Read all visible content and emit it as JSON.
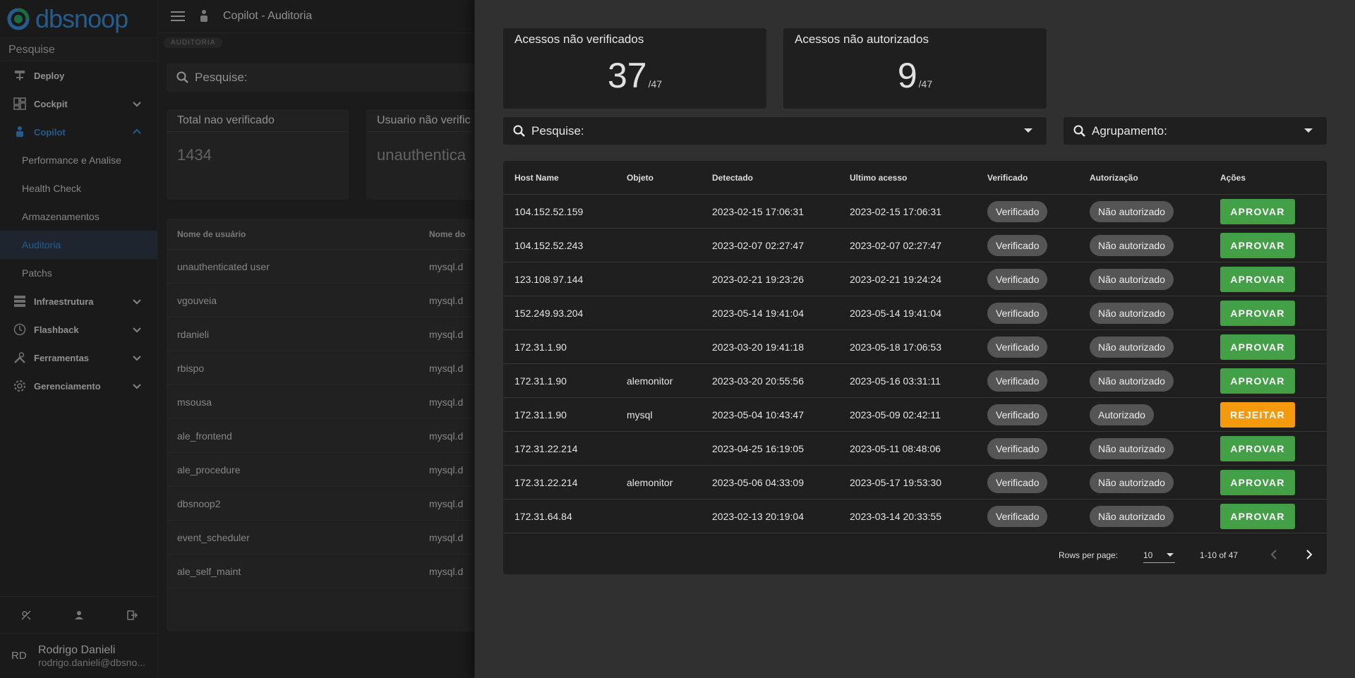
{
  "sidebar": {
    "logo_text": "dbsnoop",
    "search_placeholder": "Pesquise",
    "items": [
      {
        "label": "Deploy"
      },
      {
        "label": "Cockpit"
      },
      {
        "label": "Copilot"
      },
      {
        "label": "Infraestrutura"
      },
      {
        "label": "Flashback"
      },
      {
        "label": "Ferramentas"
      },
      {
        "label": "Gerenciamento"
      }
    ],
    "copilot_sub": [
      {
        "label": "Performance e Analise"
      },
      {
        "label": "Health Check"
      },
      {
        "label": "Armazenamentos"
      },
      {
        "label": "Auditoria"
      },
      {
        "label": "Patchs"
      }
    ],
    "user": {
      "initials": "RD",
      "name": "Rodrigo Danieli",
      "email": "rodrigo.danieli@dbsno..."
    }
  },
  "main": {
    "title": "Copilot - Auditoria",
    "breadcrumb": "AUDITORIA",
    "search_label": "Pesquise:",
    "cards": [
      {
        "label": "Total nao verificado",
        "value": "1434"
      },
      {
        "label": "Usuario não verific",
        "value": "unauthentica"
      }
    ],
    "table_headers": [
      "Nome de usuário",
      "Nome do"
    ],
    "rows": [
      {
        "user": "unauthenticated user",
        "name": "mysql.d"
      },
      {
        "user": "vgouveia",
        "name": "mysql.d"
      },
      {
        "user": "rdanieli",
        "name": "mysql.d"
      },
      {
        "user": "rbispo",
        "name": "mysql.d"
      },
      {
        "user": "msousa",
        "name": "mysql.d"
      },
      {
        "user": "ale_frontend",
        "name": "mysql.d"
      },
      {
        "user": "ale_procedure",
        "name": "mysql.d"
      },
      {
        "user": "dbsnoop2",
        "name": "mysql.d"
      },
      {
        "user": "event_scheduler",
        "name": "mysql.d"
      },
      {
        "user": "ale_self_maint",
        "name": "mysql.d"
      }
    ]
  },
  "drawer": {
    "stats": [
      {
        "label": "Acessos não verificados",
        "value": "37",
        "total": "/47"
      },
      {
        "label": "Acessos não autorizados",
        "value": "9",
        "total": "/47"
      }
    ],
    "search_label": "Pesquise:",
    "group_label": "Agrupamento:",
    "headers": [
      "Host Name",
      "Objeto",
      "Detectado",
      "Ultimo acesso",
      "Verificado",
      "Autorização",
      "Ações"
    ],
    "rows": [
      {
        "host": "104.152.52.159",
        "obj": "",
        "det": "2023-02-15 17:06:31",
        "last": "2023-02-15 17:06:31",
        "ver": "Verificado",
        "aut": "Não autorizado",
        "act": "APROVAR"
      },
      {
        "host": "104.152.52.243",
        "obj": "",
        "det": "2023-02-07 02:27:47",
        "last": "2023-02-07 02:27:47",
        "ver": "Verificado",
        "aut": "Não autorizado",
        "act": "APROVAR"
      },
      {
        "host": "123.108.97.144",
        "obj": "",
        "det": "2023-02-21 19:23:26",
        "last": "2023-02-21 19:24:24",
        "ver": "Verificado",
        "aut": "Não autorizado",
        "act": "APROVAR"
      },
      {
        "host": "152.249.93.204",
        "obj": "",
        "det": "2023-05-14 19:41:04",
        "last": "2023-05-14 19:41:04",
        "ver": "Verificado",
        "aut": "Não autorizado",
        "act": "APROVAR"
      },
      {
        "host": "172.31.1.90",
        "obj": "",
        "det": "2023-03-20 19:41:18",
        "last": "2023-05-18 17:06:53",
        "ver": "Verificado",
        "aut": "Não autorizado",
        "act": "APROVAR"
      },
      {
        "host": "172.31.1.90",
        "obj": "alemonitor",
        "det": "2023-03-20 20:55:56",
        "last": "2023-05-16 03:31:11",
        "ver": "Verificado",
        "aut": "Não autorizado",
        "act": "APROVAR"
      },
      {
        "host": "172.31.1.90",
        "obj": "mysql",
        "det": "2023-05-04 10:43:47",
        "last": "2023-05-09 02:42:11",
        "ver": "Verificado",
        "aut": "Autorizado",
        "act": "REJEITAR"
      },
      {
        "host": "172.31.22.214",
        "obj": "",
        "det": "2023-04-25 16:19:05",
        "last": "2023-05-11 08:48:06",
        "ver": "Verificado",
        "aut": "Não autorizado",
        "act": "APROVAR"
      },
      {
        "host": "172.31.22.214",
        "obj": "alemonitor",
        "det": "2023-05-06 04:33:09",
        "last": "2023-05-17 19:53:30",
        "ver": "Verificado",
        "aut": "Não autorizado",
        "act": "APROVAR"
      },
      {
        "host": "172.31.64.84",
        "obj": "",
        "det": "2023-02-13 20:19:04",
        "last": "2023-03-14 20:33:55",
        "ver": "Verificado",
        "aut": "Não autorizado",
        "act": "APROVAR"
      }
    ],
    "pagination": {
      "rows_label": "Rows per page:",
      "rows_value": "10",
      "range": "1-10 of 47"
    }
  },
  "colors": {
    "approve": "#43a047",
    "reject": "#f59a0c",
    "accent": "#3a8ed9"
  }
}
